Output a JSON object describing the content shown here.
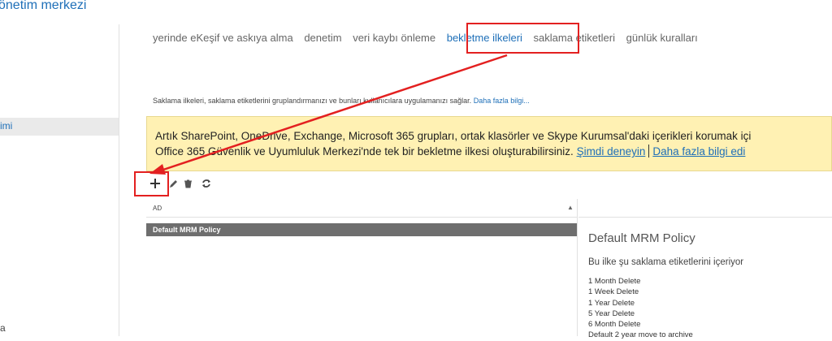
{
  "app": {
    "title": "önetim merkezi"
  },
  "sidebar": {
    "selected_item": "imi",
    "bottom_item": "a"
  },
  "tabs": [
    {
      "label": "yerinde eKeşif ve askıya alma"
    },
    {
      "label": "denetim"
    },
    {
      "label": "veri kaybı önleme"
    },
    {
      "label": "bekletme ilkeleri",
      "active": true
    },
    {
      "label": "saklama etiketleri"
    },
    {
      "label": "günlük kuralları"
    }
  ],
  "description": {
    "text": "Saklama ilkeleri, saklama etiketlerini gruplandırmanızı ve bunları kullanıcılara uygulamanızı sağlar.",
    "link": "Daha fazla bilgi..."
  },
  "banner": {
    "line1": "Artık SharePoint, OneDrive, Exchange, Microsoft 365 grupları, ortak klasörler ve Skype Kurumsal'daki içerikleri korumak içi",
    "line2": "Office 365 Güvenlik ve Uyumluluk Merkezi'nde tek bir bekletme ilkesi oluşturabilirsiniz.",
    "link_try": "Şimdi deneyin",
    "link_more": "Daha fazla bilgi edi"
  },
  "toolbar": {
    "icons": [
      "plus-icon",
      "pencil-icon",
      "trash-icon",
      "refresh-icon"
    ]
  },
  "list": {
    "column_header": "AD",
    "rows": [
      {
        "name": "Default MRM Policy"
      }
    ]
  },
  "detail": {
    "title": "Default MRM Policy",
    "subtitle": "Bu ilke şu saklama etiketlerini içeriyor",
    "tags": [
      "1 Month Delete",
      "1 Week Delete",
      "1 Year Delete",
      "5 Year Delete",
      "6 Month Delete",
      "Default 2 year move to archive"
    ]
  },
  "colors": {
    "accent": "#1e6fb8",
    "highlight": "#e32020",
    "banner_bg": "#fff1b3",
    "row_selected": "#6e6e6e"
  }
}
